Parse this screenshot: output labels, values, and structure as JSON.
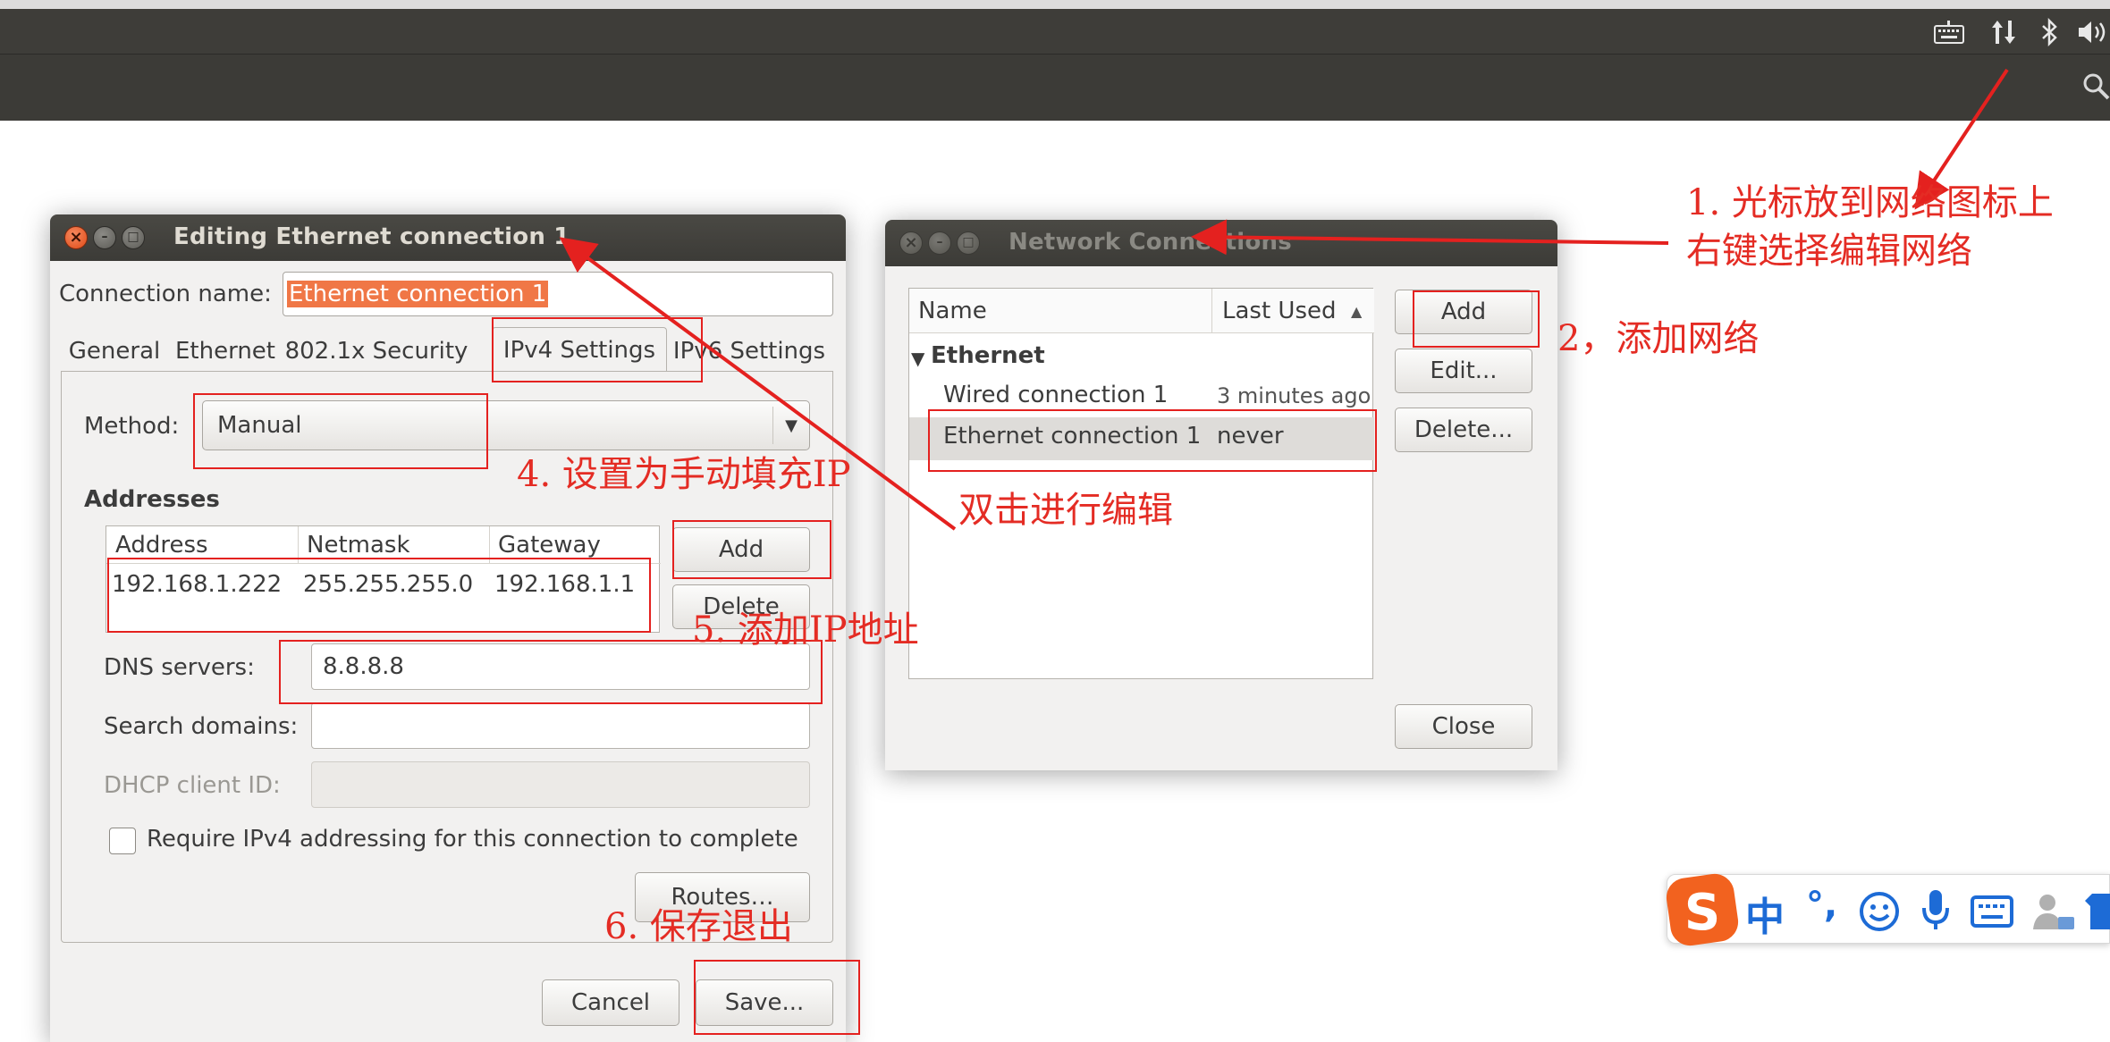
{
  "panel": {
    "icons": [
      "keyboard-icon",
      "network-arrows-icon",
      "bluetooth-icon",
      "volume-icon"
    ],
    "search_icon": "search-icon"
  },
  "edit_dialog": {
    "title": "Editing Ethernet connection 1",
    "connection_name_label": "Connection name:",
    "connection_name_value": "Ethernet connection 1",
    "tabs": [
      "General",
      "Ethernet",
      "802.1x Security",
      "IPv4 Settings",
      "IPv6 Settings"
    ],
    "active_tab": "IPv4 Settings",
    "method_label": "Method:",
    "method_value": "Manual",
    "addresses_heading": "Addresses",
    "columns": [
      "Address",
      "Netmask",
      "Gateway"
    ],
    "row": [
      "192.168.1.222",
      "255.255.255.0",
      "192.168.1.1"
    ],
    "add_label": "Add",
    "delete_label": "Delete",
    "dns_label": "DNS servers:",
    "dns_value": "8.8.8.8",
    "search_domains_label": "Search domains:",
    "dhcp_label": "DHCP client ID:",
    "require_label": "Require IPv4 addressing for this connection to complete",
    "routes_label": "Routes…",
    "cancel_label": "Cancel",
    "save_label": "Save..."
  },
  "net_dialog": {
    "title": "Network Connections",
    "col_name": "Name",
    "col_last_used": "Last Used",
    "group": "Ethernet",
    "rows": [
      {
        "name": "Wired connection 1",
        "last_used": "3 minutes ago"
      },
      {
        "name": "Ethernet connection 1",
        "last_used": "never"
      }
    ],
    "add_label": "Add",
    "edit_label": "Edit...",
    "delete_label": "Delete...",
    "close_label": "Close"
  },
  "annotations": {
    "a1_line1": "1. 光标放到网络图标上",
    "a1_line2": "右键选择编辑网络",
    "a2": "2，添加网络",
    "a3": "双击进行编辑",
    "a4": "4. 设置为手动填充IP",
    "a5": "5. 添加IP地址",
    "a6": "6. 保存退出"
  },
  "ime": {
    "chinese_label": "中",
    "punct_label": "°,"
  },
  "colors": {
    "annotation": "#e4211f",
    "selection": "#f07746",
    "panel": "#3c3b37"
  }
}
